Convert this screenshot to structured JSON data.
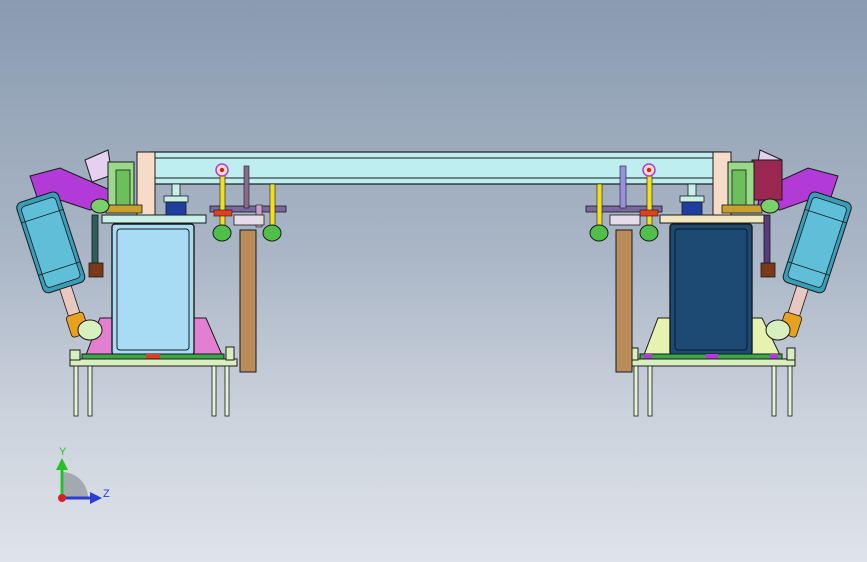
{
  "viewport": {
    "background_top": "#8a9bb0",
    "background_bottom": "#dfe3ea"
  },
  "triad": {
    "y_label": "Y",
    "z_label": "Z",
    "y_color": "#27c22a",
    "z_color": "#2a3ed6",
    "x_color": "#d92020"
  },
  "colors": {
    "beam": "#bfeef0",
    "cylinder": "#3a9db8",
    "clamp_arm": "#b23ad6",
    "light_block": "#a8dcf5",
    "dark_block": "#1c4a72",
    "post": "#b98c5a",
    "base_plate": "#d8f0c0",
    "pink_rib": "#e37fd0",
    "yellow_rod": "#f0e020"
  }
}
